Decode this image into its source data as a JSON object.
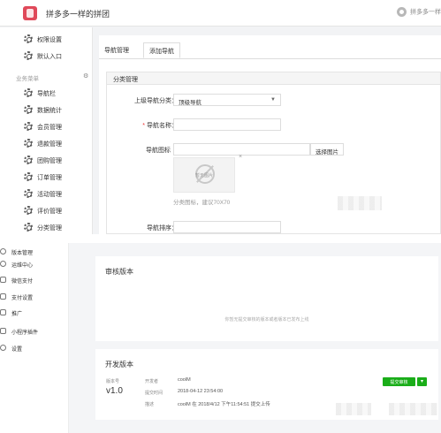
{
  "top": {
    "header": {
      "title": "拼多多一样的拼团",
      "user": "拼多多一样"
    },
    "sidebar": {
      "items_top": [
        {
          "label": "权限设置"
        },
        {
          "label": "默认入口"
        }
      ],
      "section_label": "业务菜单",
      "section_icon": "gear-icon",
      "items": [
        {
          "label": "导航栏"
        },
        {
          "label": "数据统计"
        },
        {
          "label": "会员管理"
        },
        {
          "label": "退款管理"
        },
        {
          "label": "团购管理"
        },
        {
          "label": "订单管理"
        },
        {
          "label": "活动管理"
        },
        {
          "label": "评价管理"
        },
        {
          "label": "分类管理"
        }
      ]
    },
    "main": {
      "tabs": [
        {
          "label": "导航管理"
        },
        {
          "label": "添加导航"
        }
      ],
      "panel_title": "分类管理",
      "form": {
        "parent_label": "上级导航分类：",
        "parent_value": "顶级导航",
        "name_label": "导航名称：",
        "name_value": "",
        "icon_label": "导航图标",
        "icon_value": "",
        "choose_image": "选择图片",
        "no_image": "暂无图片",
        "remove": "×",
        "hint": "分类图标，建议70X70",
        "sort_label": "导航排序：",
        "sort_value": ""
      }
    }
  },
  "bottom": {
    "sidebar": {
      "items": [
        {
          "label": "版本管理"
        },
        {
          "label": "运维中心"
        },
        {
          "label": "微信支付"
        },
        {
          "label": "支付设置"
        },
        {
          "label": "推广"
        },
        {
          "label": "小程序插件"
        },
        {
          "label": "设置"
        }
      ]
    },
    "audit": {
      "title": "审核版本",
      "empty_text": "你暂无提交审核的版本或者版本已发布上线"
    },
    "dev": {
      "title": "开发版本",
      "version_label": "版本号",
      "version": "v1.0",
      "meta": [
        {
          "key": "开发者",
          "value": "coolM"
        },
        {
          "key": "提交时间",
          "value": "2018-04-12 23:54:00"
        },
        {
          "key": "描述",
          "value": "coolM 在 2018/4/12 下午11:54:51 提交上传"
        }
      ],
      "submit_label": "提交审核",
      "dropdown_label": "▾"
    }
  }
}
